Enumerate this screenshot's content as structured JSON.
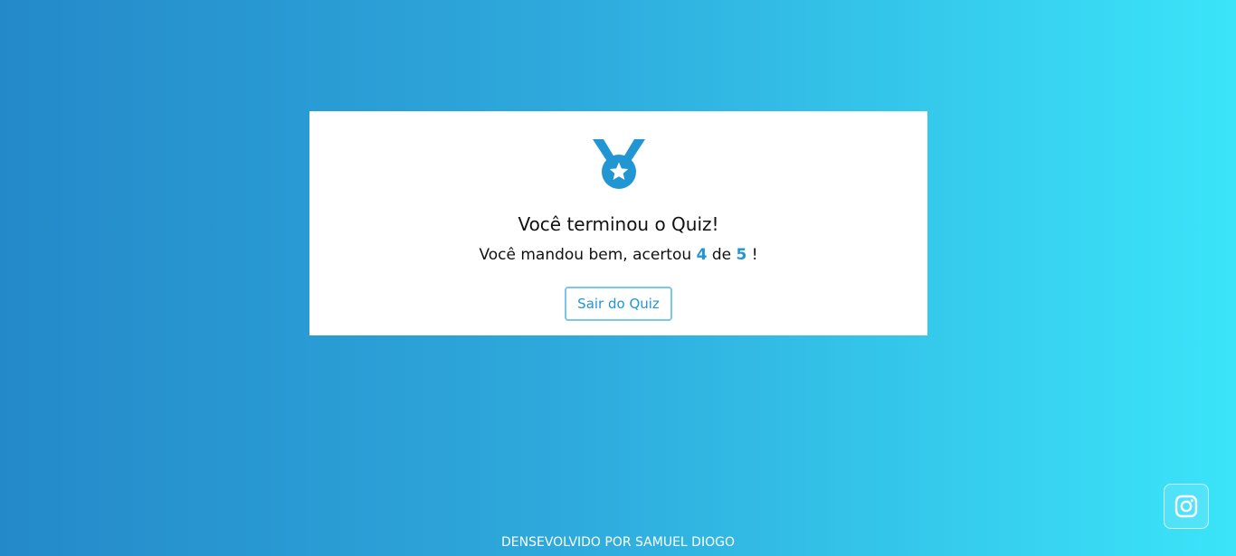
{
  "result": {
    "title": "Você terminou o Quiz!",
    "score_prefix": "Você mandou bem, acertou",
    "correct": "4",
    "score_middle": "de",
    "total": "5",
    "score_suffix": "!",
    "exit_label": "Sair do Quiz",
    "icon": "medal-icon"
  },
  "footer": {
    "credit": "DENSEVOLVIDO POR SAMUEL DIOGO"
  },
  "social": {
    "icon": "instagram-icon"
  },
  "colors": {
    "accent": "#2196d3",
    "gradient_start": "#2489c9",
    "gradient_end": "#3be4f9"
  }
}
